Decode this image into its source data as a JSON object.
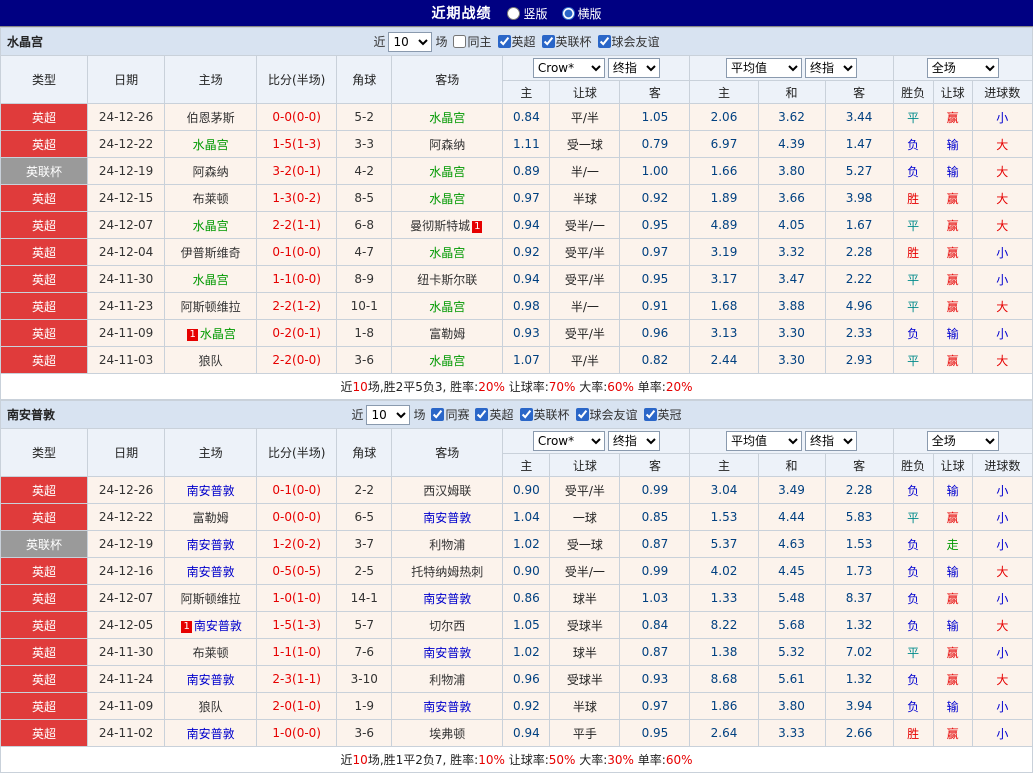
{
  "title_bar": {
    "title": "近期战绩",
    "radios": [
      {
        "label": "竖版",
        "checked": false
      },
      {
        "label": "横版",
        "checked": true
      }
    ]
  },
  "filter_words": {
    "near": "近",
    "matches": "场"
  },
  "columns": {
    "type": "类型",
    "date": "日期",
    "home": "主场",
    "score": "比分(半场)",
    "corner": "角球",
    "away": "客场",
    "odds_company": "Crow*",
    "odds_stage": "终指",
    "avg": "平均值",
    "avg_stage": "终指",
    "scope": "全场",
    "sub": {
      "home": "主",
      "handicap": "让球",
      "away": "客",
      "home2": "主",
      "draw": "和",
      "away2": "客",
      "result": "胜负",
      "handicap_result": "让球",
      "goals": "进球数"
    }
  },
  "colors": {
    "league_red": "#E03B3B",
    "league_gray": "#9A9A9A",
    "win_red": "#E60000",
    "lose_blue": "#0000D0",
    "draw_teal": "#008B8B",
    "walk_green": "#009900",
    "team_home_highlight": "#009900",
    "team_away_highlight": "#0000CC"
  },
  "sections": [
    {
      "team": "水晶宫",
      "near_value": "10",
      "checkboxes": [
        {
          "label": "同主",
          "checked": false
        },
        {
          "label": "英超",
          "checked": true
        },
        {
          "label": "英联杯",
          "checked": true
        },
        {
          "label": "球会友谊",
          "checked": true
        }
      ],
      "rows": [
        {
          "league": "英超",
          "league_class": "lg-red",
          "date": "24-12-26",
          "home": "伯恩茅斯",
          "home_class": "",
          "home_badge": "",
          "score": "0-0(0-0)",
          "corner": "5-2",
          "away": "水晶宫",
          "away_class": "team-a",
          "away_badge": "",
          "o1": "0.84",
          "hline": "平/半",
          "o2": "1.05",
          "avg_h": "2.06",
          "avg_d": "3.62",
          "avg_a": "3.44",
          "res": "平",
          "res_c": "c-teal",
          "hres": "赢",
          "hres_c": "c-red",
          "gres": "小",
          "gres_c": "c-blue"
        },
        {
          "league": "英超",
          "league_class": "lg-red",
          "date": "24-12-22",
          "home": "水晶宫",
          "home_class": "team-a",
          "home_badge": "",
          "score": "1-5(1-3)",
          "corner": "3-3",
          "away": "阿森纳",
          "away_class": "",
          "away_badge": "",
          "o1": "1.11",
          "hline": "受一球",
          "o2": "0.79",
          "avg_h": "6.97",
          "avg_d": "4.39",
          "avg_a": "1.47",
          "res": "负",
          "res_c": "c-blue",
          "hres": "输",
          "hres_c": "c-blue",
          "gres": "大",
          "gres_c": "c-red"
        },
        {
          "league": "英联杯",
          "league_class": "lg-gray",
          "date": "24-12-19",
          "home": "阿森纳",
          "home_class": "",
          "home_badge": "",
          "score": "3-2(0-1)",
          "corner": "4-2",
          "away": "水晶宫",
          "away_class": "team-a",
          "away_badge": "",
          "o1": "0.89",
          "hline": "半/一",
          "o2": "1.00",
          "avg_h": "1.66",
          "avg_d": "3.80",
          "avg_a": "5.27",
          "res": "负",
          "res_c": "c-blue",
          "hres": "输",
          "hres_c": "c-blue",
          "gres": "大",
          "gres_c": "c-red"
        },
        {
          "league": "英超",
          "league_class": "lg-red",
          "date": "24-12-15",
          "home": "布莱顿",
          "home_class": "",
          "home_badge": "",
          "score": "1-3(0-2)",
          "corner": "8-5",
          "away": "水晶宫",
          "away_class": "team-a",
          "away_badge": "",
          "o1": "0.97",
          "hline": "半球",
          "o2": "0.92",
          "avg_h": "1.89",
          "avg_d": "3.66",
          "avg_a": "3.98",
          "res": "胜",
          "res_c": "c-red",
          "hres": "赢",
          "hres_c": "c-red",
          "gres": "大",
          "gres_c": "c-red"
        },
        {
          "league": "英超",
          "league_class": "lg-red",
          "date": "24-12-07",
          "home": "水晶宫",
          "home_class": "team-a",
          "home_badge": "",
          "score": "2-2(1-1)",
          "corner": "6-8",
          "away": "曼彻斯特城",
          "away_class": "",
          "away_badge": "1",
          "o1": "0.94",
          "hline": "受半/一",
          "o2": "0.95",
          "avg_h": "4.89",
          "avg_d": "4.05",
          "avg_a": "1.67",
          "res": "平",
          "res_c": "c-teal",
          "hres": "赢",
          "hres_c": "c-red",
          "gres": "大",
          "gres_c": "c-red"
        },
        {
          "league": "英超",
          "league_class": "lg-red",
          "date": "24-12-04",
          "home": "伊普斯维奇",
          "home_class": "",
          "home_badge": "",
          "score": "0-1(0-0)",
          "corner": "4-7",
          "away": "水晶宫",
          "away_class": "team-a",
          "away_badge": "",
          "o1": "0.92",
          "hline": "受平/半",
          "o2": "0.97",
          "avg_h": "3.19",
          "avg_d": "3.32",
          "avg_a": "2.28",
          "res": "胜",
          "res_c": "c-red",
          "hres": "赢",
          "hres_c": "c-red",
          "gres": "小",
          "gres_c": "c-blue"
        },
        {
          "league": "英超",
          "league_class": "lg-red",
          "date": "24-11-30",
          "home": "水晶宫",
          "home_class": "team-a",
          "home_badge": "",
          "score": "1-1(0-0)",
          "corner": "8-9",
          "away": "纽卡斯尔联",
          "away_class": "",
          "away_badge": "",
          "o1": "0.94",
          "hline": "受平/半",
          "o2": "0.95",
          "avg_h": "3.17",
          "avg_d": "3.47",
          "avg_a": "2.22",
          "res": "平",
          "res_c": "c-teal",
          "hres": "赢",
          "hres_c": "c-red",
          "gres": "小",
          "gres_c": "c-blue"
        },
        {
          "league": "英超",
          "league_class": "lg-red",
          "date": "24-11-23",
          "home": "阿斯顿维拉",
          "home_class": "",
          "home_badge": "",
          "score": "2-2(1-2)",
          "corner": "10-1",
          "away": "水晶宫",
          "away_class": "team-a",
          "away_badge": "",
          "o1": "0.98",
          "hline": "半/一",
          "o2": "0.91",
          "avg_h": "1.68",
          "avg_d": "3.88",
          "avg_a": "4.96",
          "res": "平",
          "res_c": "c-teal",
          "hres": "赢",
          "hres_c": "c-red",
          "gres": "大",
          "gres_c": "c-red"
        },
        {
          "league": "英超",
          "league_class": "lg-red",
          "date": "24-11-09",
          "home": "水晶宫",
          "home_class": "team-a",
          "home_badge": "1",
          "score": "0-2(0-1)",
          "corner": "1-8",
          "away": "富勒姆",
          "away_class": "",
          "away_badge": "",
          "o1": "0.93",
          "hline": "受平/半",
          "o2": "0.96",
          "avg_h": "3.13",
          "avg_d": "3.30",
          "avg_a": "2.33",
          "res": "负",
          "res_c": "c-blue",
          "hres": "输",
          "hres_c": "c-blue",
          "gres": "小",
          "gres_c": "c-blue"
        },
        {
          "league": "英超",
          "league_class": "lg-red",
          "date": "24-11-03",
          "home": "狼队",
          "home_class": "",
          "home_badge": "",
          "score": "2-2(0-0)",
          "corner": "3-6",
          "away": "水晶宫",
          "away_class": "team-a",
          "away_badge": "",
          "o1": "1.07",
          "hline": "平/半",
          "o2": "0.82",
          "avg_h": "2.44",
          "avg_d": "3.30",
          "avg_a": "2.93",
          "res": "平",
          "res_c": "c-teal",
          "hres": "赢",
          "hres_c": "c-red",
          "gres": "大",
          "gres_c": "c-red"
        }
      ],
      "summary": [
        {
          "text": "近",
          "cls": ""
        },
        {
          "text": "10",
          "cls": "red"
        },
        {
          "text": "场,胜2平5负3, 胜率:",
          "cls": ""
        },
        {
          "text": "20%",
          "cls": "red"
        },
        {
          "text": " 让球率:",
          "cls": ""
        },
        {
          "text": "70%",
          "cls": "red"
        },
        {
          "text": " 大率:",
          "cls": ""
        },
        {
          "text": "60%",
          "cls": "red"
        },
        {
          "text": " 单率:",
          "cls": ""
        },
        {
          "text": "20%",
          "cls": "red"
        }
      ]
    },
    {
      "team": "南安普敦",
      "near_value": "10",
      "checkboxes": [
        {
          "label": "同赛",
          "checked": true
        },
        {
          "label": "英超",
          "checked": true
        },
        {
          "label": "英联杯",
          "checked": true
        },
        {
          "label": "球会友谊",
          "checked": true
        },
        {
          "label": "英冠",
          "checked": true
        }
      ],
      "rows": [
        {
          "league": "英超",
          "league_class": "lg-red",
          "date": "24-12-26",
          "home": "南安普敦",
          "home_class": "team-b",
          "home_badge": "",
          "score": "0-1(0-0)",
          "corner": "2-2",
          "away": "西汉姆联",
          "away_class": "",
          "away_badge": "",
          "o1": "0.90",
          "hline": "受平/半",
          "o2": "0.99",
          "avg_h": "3.04",
          "avg_d": "3.49",
          "avg_a": "2.28",
          "res": "负",
          "res_c": "c-blue",
          "hres": "输",
          "hres_c": "c-blue",
          "gres": "小",
          "gres_c": "c-blue"
        },
        {
          "league": "英超",
          "league_class": "lg-red",
          "date": "24-12-22",
          "home": "富勒姆",
          "home_class": "",
          "home_badge": "",
          "score": "0-0(0-0)",
          "corner": "6-5",
          "away": "南安普敦",
          "away_class": "team-b",
          "away_badge": "",
          "o1": "1.04",
          "hline": "一球",
          "o2": "0.85",
          "avg_h": "1.53",
          "avg_d": "4.44",
          "avg_a": "5.83",
          "res": "平",
          "res_c": "c-teal",
          "hres": "赢",
          "hres_c": "c-red",
          "gres": "小",
          "gres_c": "c-blue"
        },
        {
          "league": "英联杯",
          "league_class": "lg-gray",
          "date": "24-12-19",
          "home": "南安普敦",
          "home_class": "team-b",
          "home_badge": "",
          "score": "1-2(0-2)",
          "corner": "3-7",
          "away": "利物浦",
          "away_class": "",
          "away_badge": "",
          "o1": "1.02",
          "hline": "受一球",
          "o2": "0.87",
          "avg_h": "5.37",
          "avg_d": "4.63",
          "avg_a": "1.53",
          "res": "负",
          "res_c": "c-blue",
          "hres": "走",
          "hres_c": "c-green",
          "gres": "小",
          "gres_c": "c-blue"
        },
        {
          "league": "英超",
          "league_class": "lg-red",
          "date": "24-12-16",
          "home": "南安普敦",
          "home_class": "team-b",
          "home_badge": "",
          "score": "0-5(0-5)",
          "corner": "2-5",
          "away": "托特纳姆热刺",
          "away_class": "",
          "away_badge": "",
          "o1": "0.90",
          "hline": "受半/一",
          "o2": "0.99",
          "avg_h": "4.02",
          "avg_d": "4.45",
          "avg_a": "1.73",
          "res": "负",
          "res_c": "c-blue",
          "hres": "输",
          "hres_c": "c-blue",
          "gres": "大",
          "gres_c": "c-red"
        },
        {
          "league": "英超",
          "league_class": "lg-red",
          "date": "24-12-07",
          "home": "阿斯顿维拉",
          "home_class": "",
          "home_badge": "",
          "score": "1-0(1-0)",
          "corner": "14-1",
          "away": "南安普敦",
          "away_class": "team-b",
          "away_badge": "",
          "o1": "0.86",
          "hline": "球半",
          "o2": "1.03",
          "avg_h": "1.33",
          "avg_d": "5.48",
          "avg_a": "8.37",
          "res": "负",
          "res_c": "c-blue",
          "hres": "赢",
          "hres_c": "c-red",
          "gres": "小",
          "gres_c": "c-blue"
        },
        {
          "league": "英超",
          "league_class": "lg-red",
          "date": "24-12-05",
          "home": "南安普敦",
          "home_class": "team-b",
          "home_badge": "1",
          "score": "1-5(1-3)",
          "corner": "5-7",
          "away": "切尔西",
          "away_class": "",
          "away_badge": "",
          "o1": "1.05",
          "hline": "受球半",
          "o2": "0.84",
          "avg_h": "8.22",
          "avg_d": "5.68",
          "avg_a": "1.32",
          "res": "负",
          "res_c": "c-blue",
          "hres": "输",
          "hres_c": "c-blue",
          "gres": "大",
          "gres_c": "c-red"
        },
        {
          "league": "英超",
          "league_class": "lg-red",
          "date": "24-11-30",
          "home": "布莱顿",
          "home_class": "",
          "home_badge": "",
          "score": "1-1(1-0)",
          "corner": "7-6",
          "away": "南安普敦",
          "away_class": "team-b",
          "away_badge": "",
          "o1": "1.02",
          "hline": "球半",
          "o2": "0.87",
          "avg_h": "1.38",
          "avg_d": "5.32",
          "avg_a": "7.02",
          "res": "平",
          "res_c": "c-teal",
          "hres": "赢",
          "hres_c": "c-red",
          "gres": "小",
          "gres_c": "c-blue"
        },
        {
          "league": "英超",
          "league_class": "lg-red",
          "date": "24-11-24",
          "home": "南安普敦",
          "home_class": "team-b",
          "home_badge": "",
          "score": "2-3(1-1)",
          "corner": "3-10",
          "away": "利物浦",
          "away_class": "",
          "away_badge": "",
          "o1": "0.96",
          "hline": "受球半",
          "o2": "0.93",
          "avg_h": "8.68",
          "avg_d": "5.61",
          "avg_a": "1.32",
          "res": "负",
          "res_c": "c-blue",
          "hres": "赢",
          "hres_c": "c-red",
          "gres": "大",
          "gres_c": "c-red"
        },
        {
          "league": "英超",
          "league_class": "lg-red",
          "date": "24-11-09",
          "home": "狼队",
          "home_class": "",
          "home_badge": "",
          "score": "2-0(1-0)",
          "corner": "1-9",
          "away": "南安普敦",
          "away_class": "team-b",
          "away_badge": "",
          "o1": "0.92",
          "hline": "半球",
          "o2": "0.97",
          "avg_h": "1.86",
          "avg_d": "3.80",
          "avg_a": "3.94",
          "res": "负",
          "res_c": "c-blue",
          "hres": "输",
          "hres_c": "c-blue",
          "gres": "小",
          "gres_c": "c-blue"
        },
        {
          "league": "英超",
          "league_class": "lg-red",
          "date": "24-11-02",
          "home": "南安普敦",
          "home_class": "team-b",
          "home_badge": "",
          "score": "1-0(0-0)",
          "corner": "3-6",
          "away": "埃弗顿",
          "away_class": "",
          "away_badge": "",
          "o1": "0.94",
          "hline": "平手",
          "o2": "0.95",
          "avg_h": "2.64",
          "avg_d": "3.33",
          "avg_a": "2.66",
          "res": "胜",
          "res_c": "c-red",
          "hres": "赢",
          "hres_c": "c-red",
          "gres": "小",
          "gres_c": "c-blue"
        }
      ],
      "summary": [
        {
          "text": "近",
          "cls": ""
        },
        {
          "text": "10",
          "cls": "red"
        },
        {
          "text": "场,胜1平2负7, 胜率:",
          "cls": ""
        },
        {
          "text": "10%",
          "cls": "red"
        },
        {
          "text": " 让球率:",
          "cls": ""
        },
        {
          "text": "50%",
          "cls": "red"
        },
        {
          "text": " 大率:",
          "cls": ""
        },
        {
          "text": "30%",
          "cls": "red"
        },
        {
          "text": " 单率:",
          "cls": ""
        },
        {
          "text": "60%",
          "cls": "red"
        }
      ]
    }
  ]
}
